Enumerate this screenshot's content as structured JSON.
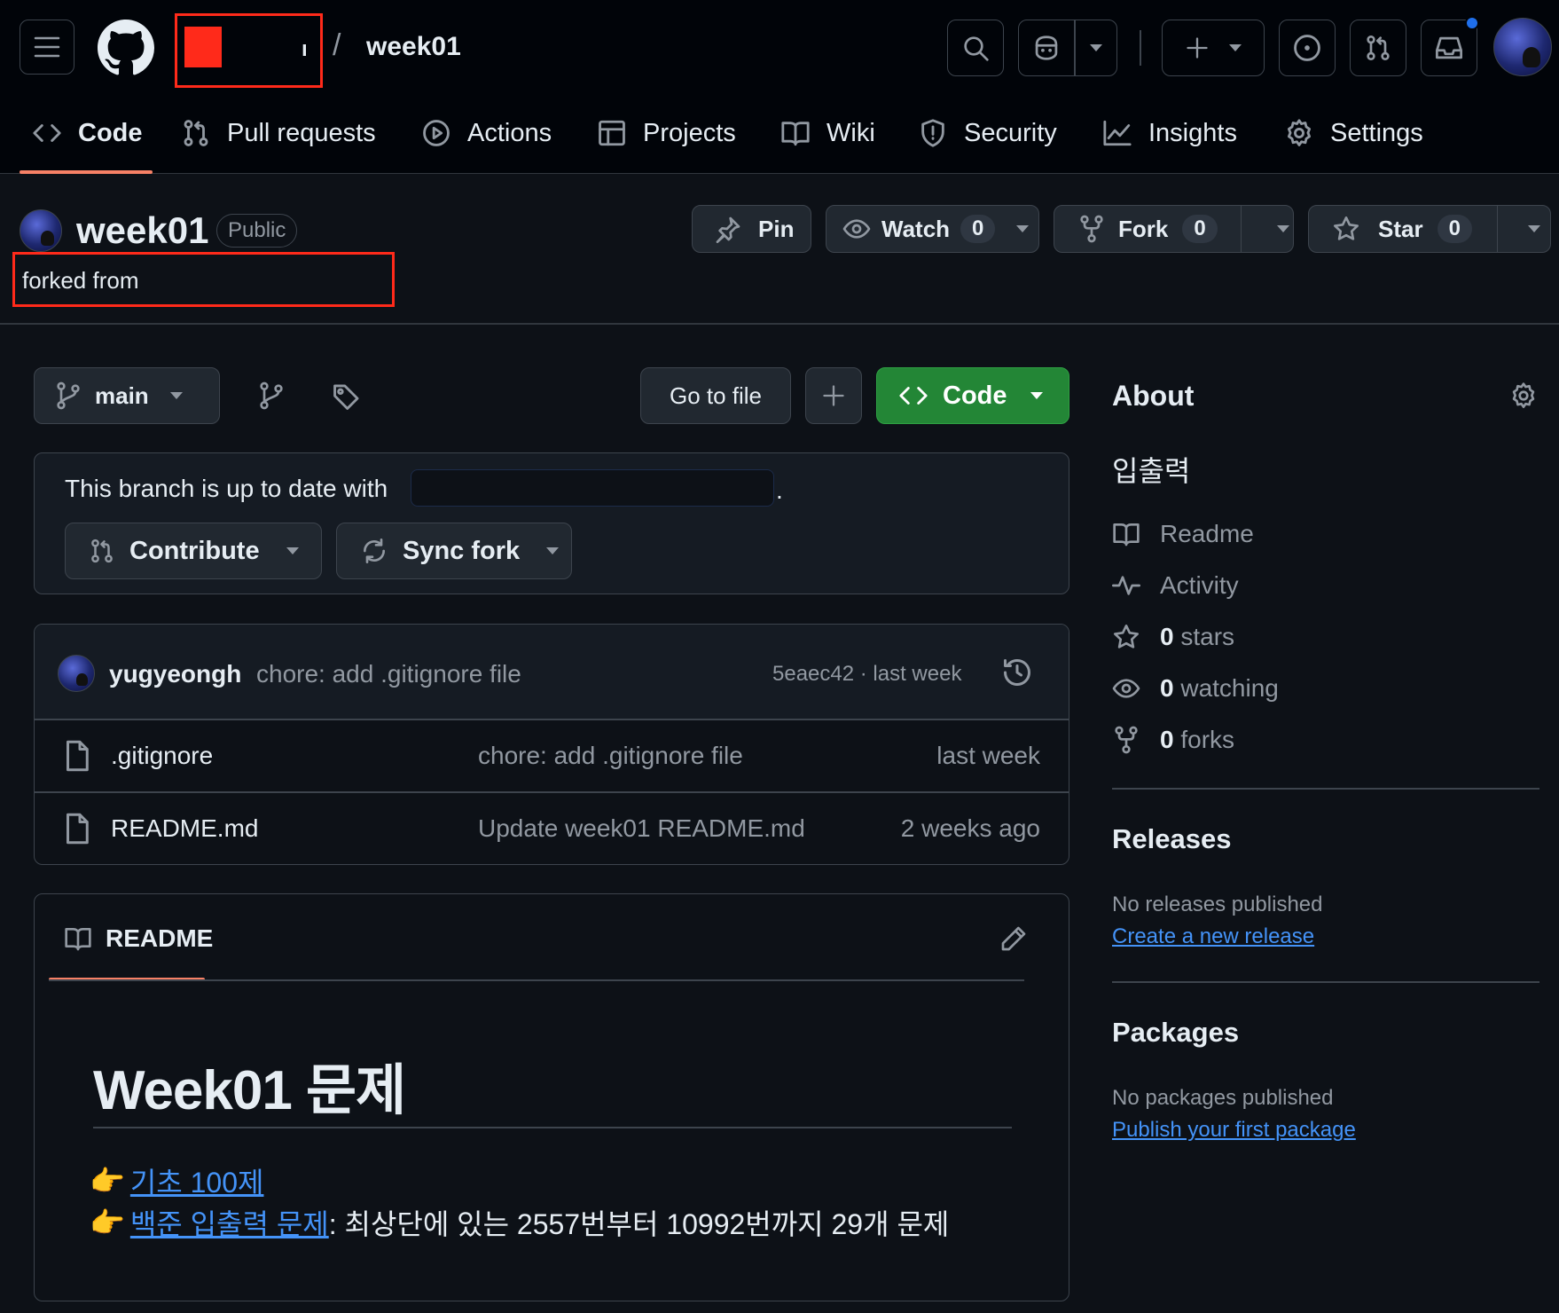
{
  "header": {
    "owner": "ı",
    "repo": "week01",
    "separator": "/"
  },
  "nav": {
    "code": "Code",
    "pull_requests": "Pull requests",
    "actions": "Actions",
    "projects": "Projects",
    "wiki": "Wiki",
    "security": "Security",
    "insights": "Insights",
    "settings": "Settings"
  },
  "repo": {
    "name": "week01",
    "visibility": "Public",
    "forked_from_label": "forked from",
    "pin": "Pin",
    "watch": "Watch",
    "watch_count": "0",
    "fork": "Fork",
    "fork_count": "0",
    "star": "Star",
    "star_count": "0"
  },
  "toolbar": {
    "branch": "main",
    "go_to_file": "Go to file",
    "code_button": "Code"
  },
  "fork_status": {
    "text": "This branch is up to date with",
    "period": ".",
    "contribute": "Contribute",
    "sync_fork": "Sync fork"
  },
  "commit": {
    "author": "yugyeongh",
    "message": "chore: add .gitignore file",
    "sha_time": "5eaec42 · last week"
  },
  "files": [
    {
      "name": ".gitignore",
      "message": "chore: add .gitignore file",
      "time": "last week"
    },
    {
      "name": "README.md",
      "message": "Update week01 README.md",
      "time": "2 weeks ago"
    }
  ],
  "readme": {
    "tab": "README",
    "heading": "Week01 문제",
    "item1_link": "기초 100제",
    "item2_link": "백준 입출력 문제",
    "item2_rest": ": 최상단에 있는 2557번부터 10992번까지 29개 문제",
    "emoji": "👉"
  },
  "about": {
    "title": "About",
    "description": "입출력",
    "readme": "Readme",
    "activity": "Activity",
    "stars_num": "0",
    "stars_label": "stars",
    "watching_num": "0",
    "watching_label": "watching",
    "forks_num": "0",
    "forks_label": "forks"
  },
  "releases": {
    "title": "Releases",
    "empty": "No releases published",
    "link": "Create a new release"
  },
  "packages": {
    "title": "Packages",
    "empty": "No packages published",
    "link": "Publish your first package"
  },
  "colors": {
    "background": "#0d1117",
    "header": "#010409",
    "accent_underline": "#f78166",
    "green": "#238636",
    "link": "#4493f8",
    "redaction": "#ff2a1a"
  }
}
